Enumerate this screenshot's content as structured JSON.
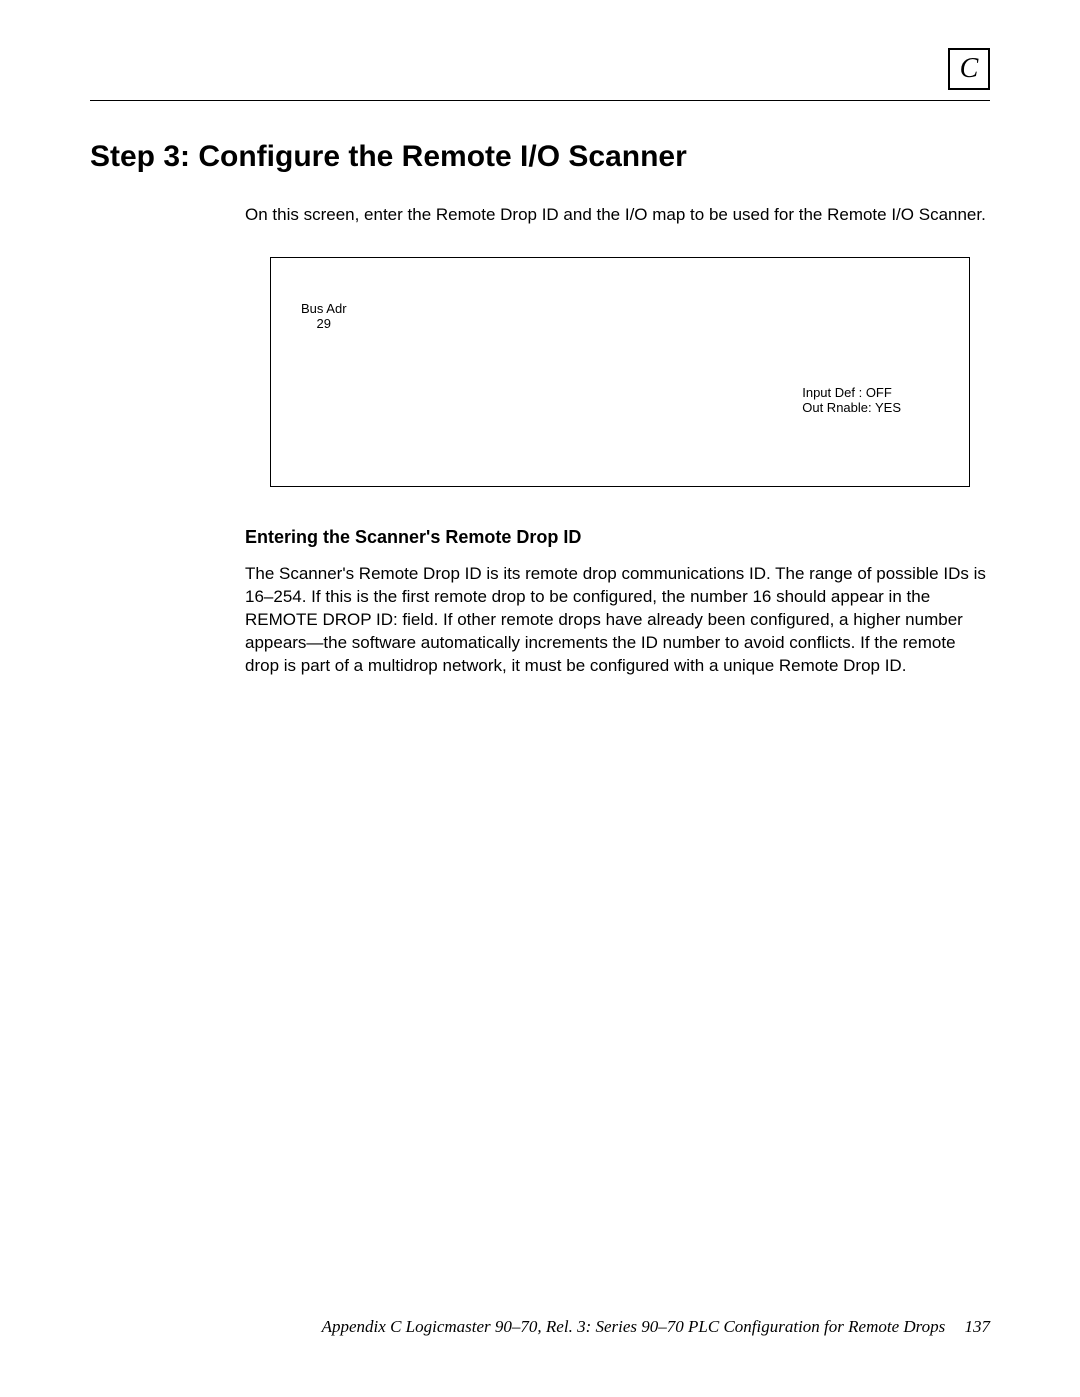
{
  "appendixLetter": "C",
  "sectionTitle": "Step 3: Configure the Remote I/O Scanner",
  "introParagraph": "On this screen, enter the Remote Drop ID and the I/O map to be used for the Remote I/O Scanner.",
  "screenBox": {
    "busAdrLabel": "Bus Adr",
    "busAdrValue": "29",
    "inputDefLine": "Input Def :  OFF",
    "outRnableLine": "Out Rnable:  YES"
  },
  "subHeading": "Entering the Scanner's Remote Drop ID",
  "bodyParagraph": "The Scanner's Remote Drop ID is its remote drop communications ID.  The range of possible IDs is 16–254.  If this is the first remote drop to be configured, the number 16 should appear in the REMOTE DROP ID: field.  If other remote drops have already been configured, a higher number appears—the software automatically increments the ID number to avoid conflicts.  If the remote drop is part of a multidrop network, it must be configured with a unique Remote Drop ID.",
  "footer": {
    "text": "Appendix C Logicmaster 90–70, Rel. 3: Series 90–70 PLC Configuration for Remote Drops",
    "pageNumber": "137"
  }
}
